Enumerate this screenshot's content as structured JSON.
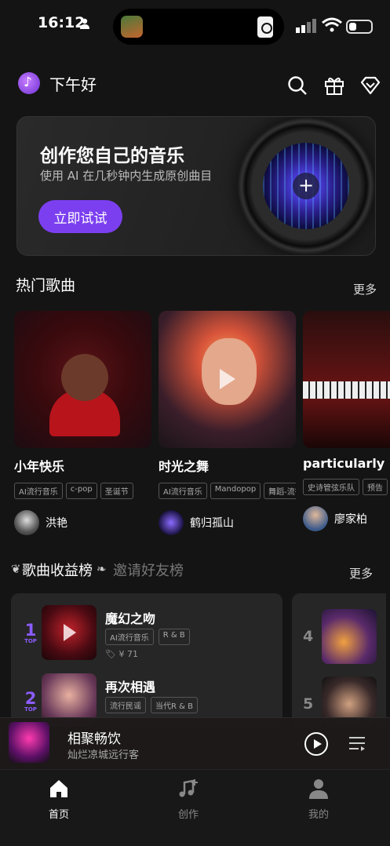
{
  "status_bar": {
    "time": "16:12",
    "battery_level": 0.35
  },
  "header": {
    "greeting": "下午好"
  },
  "banner": {
    "title": "创作您自己的音乐",
    "subtitle": "使用 AI 在几秒钟内生成原创曲目",
    "cta_label": "立即试试",
    "plus": "+"
  },
  "hot_songs": {
    "title": "热门歌曲",
    "more": "更多",
    "items": [
      {
        "name": "小年快乐",
        "tags": [
          "AI流行音乐",
          "c-pop",
          "圣诞节"
        ],
        "author": "洪艳"
      },
      {
        "name": "时光之舞",
        "tags": [
          "AI流行音乐",
          "Mandopop",
          "舞蹈-流行"
        ],
        "author": "鹤归孤山"
      },
      {
        "name": "particularly",
        "tags": [
          "史诗管弦乐队",
          "预告"
        ],
        "author": "廖家柏"
      }
    ]
  },
  "leaderboard": {
    "tab_active": "歌曲收益榜",
    "tab_inactive": "邀请好友榜",
    "more": "更多",
    "top_label": "TOP",
    "items": [
      {
        "rank": "1",
        "name": "魔幻之吻",
        "tags": [
          "AI流行音乐",
          "R & B"
        ],
        "price": "¥ 71"
      },
      {
        "rank": "2",
        "name": "再次相遇",
        "tags": [
          "流行民谣",
          "当代R & B"
        ],
        "price": ""
      }
    ],
    "side_ranks": [
      "4",
      "5"
    ]
  },
  "player": {
    "title": "相聚畅饮",
    "artist": "灿烂凉城远行客"
  },
  "tabs": [
    {
      "label": "首页",
      "active": true
    },
    {
      "label": "创作",
      "active": false
    },
    {
      "label": "我的",
      "active": false
    }
  ],
  "colors": {
    "accent": "#7b3ff0",
    "rank": "#8b5cff",
    "background": "#141414"
  }
}
